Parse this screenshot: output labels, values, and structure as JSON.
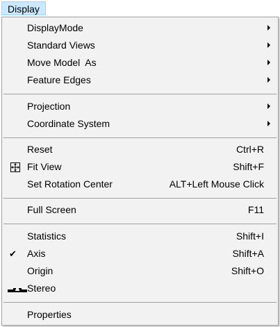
{
  "menubar": {
    "title": "Display"
  },
  "menu": {
    "groups": [
      {
        "items": [
          {
            "label": "DisplayMode",
            "submenu": true
          },
          {
            "label": "Standard Views",
            "submenu": true
          },
          {
            "label": "Move Model  As",
            "submenu": true
          },
          {
            "label": "Feature Edges",
            "submenu": true
          }
        ]
      },
      {
        "items": [
          {
            "label": "Projection",
            "submenu": true
          },
          {
            "label": "Coordinate System",
            "submenu": true
          }
        ]
      },
      {
        "items": [
          {
            "label": "Reset",
            "shortcut": "Ctrl+R"
          },
          {
            "label": "Fit View",
            "shortcut": "Shift+F",
            "icon": "fit-view-icon"
          },
          {
            "label": "Set Rotation Center",
            "shortcut": "ALT+Left Mouse Click"
          }
        ]
      },
      {
        "items": [
          {
            "label": "Full Screen",
            "shortcut": "F11"
          }
        ]
      },
      {
        "items": [
          {
            "label": "Statistics",
            "shortcut": "Shift+I"
          },
          {
            "label": "Axis",
            "shortcut": "Shift+A",
            "checked": true,
            "check_mark": "✔"
          },
          {
            "label": "Origin",
            "shortcut": "Shift+O"
          },
          {
            "label": "Stereo",
            "icon": "stereo-icon"
          }
        ]
      },
      {
        "items": [
          {
            "label": "Properties"
          }
        ]
      }
    ]
  }
}
